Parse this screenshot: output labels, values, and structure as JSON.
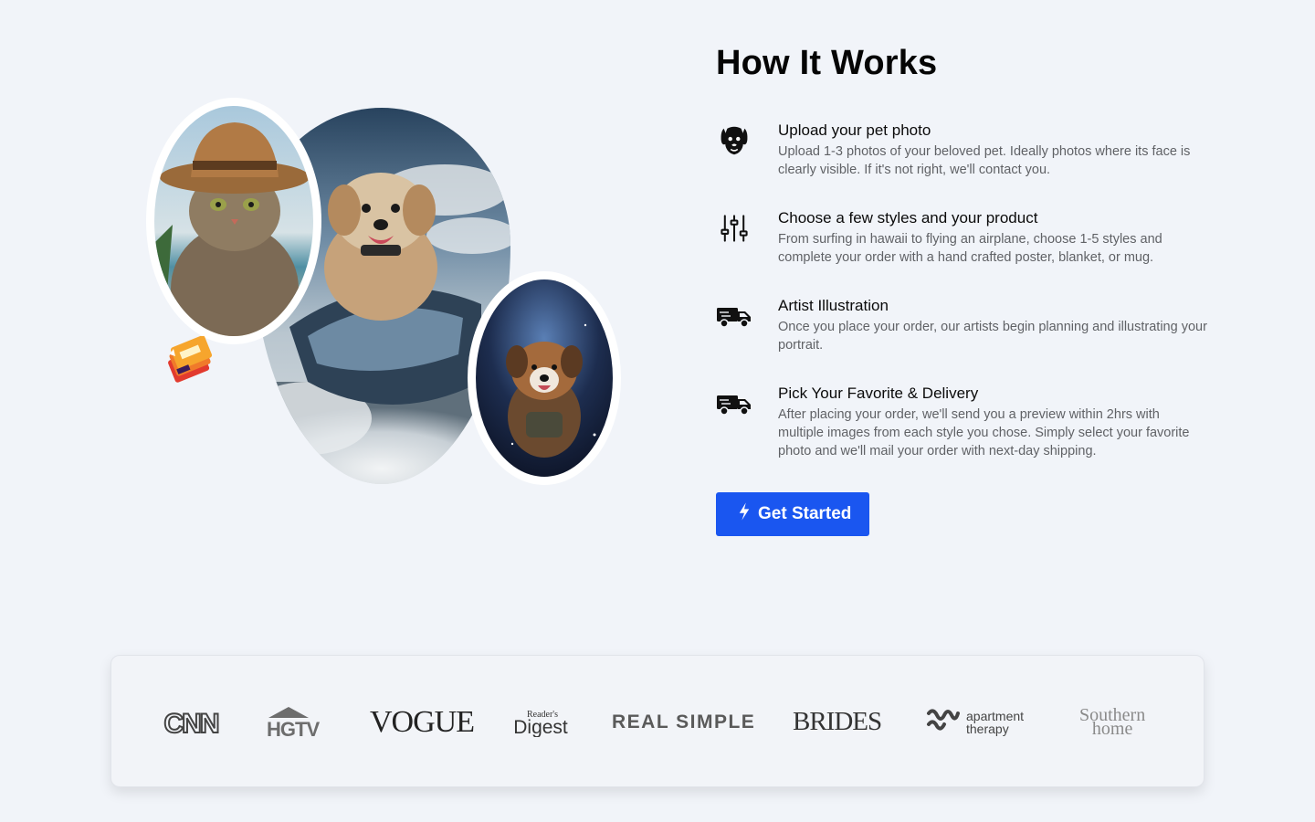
{
  "how_it_works": {
    "title": "How It Works",
    "steps": [
      {
        "icon": "dog-face-icon",
        "title": "Upload your pet photo",
        "description": "Upload 1-3 photos of your beloved pet. Ideally photos where its face is clearly visible. If it's not right, we'll contact you."
      },
      {
        "icon": "sliders-icon",
        "title": "Choose a few styles and your product",
        "description": "From surfing in hawaii to flying an airplane, choose 1-5 styles and complete your order with a hand crafted poster, blanket, or mug."
      },
      {
        "icon": "delivery-truck-icon",
        "title": "Artist Illustration",
        "description": "Once you place your order, our artists begin planning and illustrating your portrait."
      },
      {
        "icon": "delivery-truck-icon",
        "title": "Pick Your Favorite & Delivery",
        "description": "After placing your order, we'll send you a preview within 2hrs with multiple images from each style you chose. Simply select your favorite photo and we'll mail your order with next-day shipping."
      }
    ],
    "cta_label": "Get Started",
    "cta_icon": "lightning-icon"
  },
  "press": {
    "logos": [
      {
        "name": "CNN",
        "text": "CNN"
      },
      {
        "name": "HGTV",
        "text": "HGTV"
      },
      {
        "name": "VOGUE",
        "text": "VOGUE"
      },
      {
        "name": "Reader's Digest",
        "text_top": "Reader's",
        "text_bottom": "Digest"
      },
      {
        "name": "REAL SIMPLE",
        "text": "REAL SIMPLE"
      },
      {
        "name": "BRIDES",
        "text": "BRIDES"
      },
      {
        "name": "apartment therapy",
        "text_top": "apartment",
        "text_bottom": "therapy"
      },
      {
        "name": "Southern home",
        "text_top": "Southern",
        "text_bottom": "home"
      }
    ]
  },
  "colors": {
    "background": "#f1f4f9",
    "accent": "#1a56f0",
    "muted_text": "#606266"
  }
}
